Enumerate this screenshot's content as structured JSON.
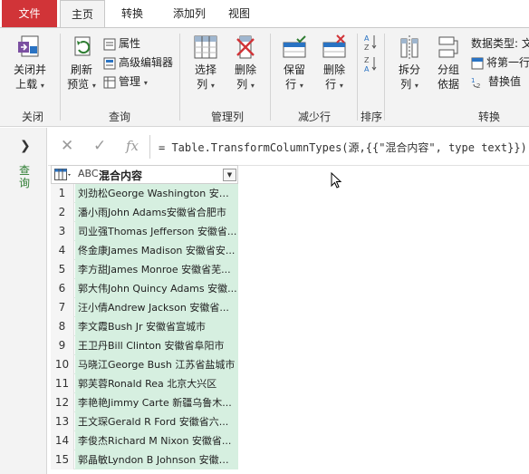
{
  "tabs": {
    "file": "文件",
    "home": "主页",
    "transform": "转换",
    "add_column": "添加列",
    "view": "视图"
  },
  "ribbon": {
    "close_load": [
      "关闭并",
      "上载"
    ],
    "refresh_preview": [
      "刷新",
      "预览"
    ],
    "properties": "属性",
    "advanced_editor": "高级编辑器",
    "manage": "管理",
    "choose_columns": [
      "选择",
      "列"
    ],
    "remove_columns": [
      "删除",
      "列"
    ],
    "keep_rows": [
      "保留",
      "行"
    ],
    "remove_rows": [
      "删除",
      "行"
    ],
    "split_column": [
      "拆分",
      "列"
    ],
    "group_by": [
      "分组",
      "依据"
    ],
    "data_type": "数据类型: 文",
    "use_first_row": "将第一行",
    "replace_values": "替换值",
    "groups": {
      "close": "关闭",
      "query": "查询",
      "manage_columns": "管理列",
      "reduce_rows": "减少行",
      "sort": "排序",
      "transform": "转换"
    }
  },
  "left_pane": {
    "label": "查询"
  },
  "formula_bar": {
    "cancel": "✕",
    "confirm": "✓",
    "fx": "fx",
    "formula": "= Table.TransformColumnTypes(源,{{\"混合内容\", type text}})"
  },
  "table": {
    "column_type": "ABC",
    "column_name": "混合内容",
    "rows": [
      {
        "n": "1",
        "v": "刘劲松George Washington 安徽..."
      },
      {
        "n": "2",
        "v": "潘小雨John Adams安徽省合肥市"
      },
      {
        "n": "3",
        "v": "司业强Thomas Jefferson 安徽省..."
      },
      {
        "n": "4",
        "v": "佟金康James Madison 安徽省安..."
      },
      {
        "n": "5",
        "v": "李方甜James Monroe 安徽省芜..."
      },
      {
        "n": "6",
        "v": "郭大伟John Quincy Adams 安徽..."
      },
      {
        "n": "7",
        "v": "汪小倩Andrew Jackson 安徽省..."
      },
      {
        "n": "8",
        "v": "李文霞Bush Jr 安徽省宣城市"
      },
      {
        "n": "9",
        "v": "王卫丹Bill Clinton 安徽省阜阳市"
      },
      {
        "n": "10",
        "v": "马晓江George Bush 江苏省盐城市"
      },
      {
        "n": "11",
        "v": "郭芙蓉Ronald Rea 北京大兴区"
      },
      {
        "n": "12",
        "v": "李艳艳Jimmy Carte 新疆乌鲁木..."
      },
      {
        "n": "13",
        "v": "王文琛Gerald R Ford 安徽省六..."
      },
      {
        "n": "14",
        "v": "李俊杰Richard M Nixon 安徽省..."
      },
      {
        "n": "15",
        "v": "郭晶敏Lyndon B Johnson 安徽省..."
      }
    ]
  }
}
